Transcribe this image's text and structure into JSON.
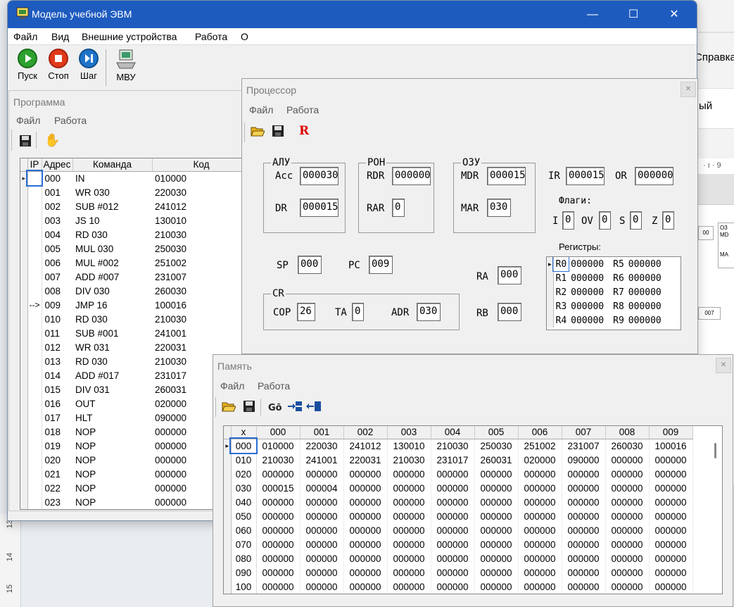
{
  "app": {
    "title": "Модель учебной ЭВМ"
  },
  "menu": [
    "Файл",
    "Вид",
    "Внешние устройства",
    "Работа",
    "О"
  ],
  "toolbar": {
    "run": "Пуск",
    "stop": "Стоп",
    "step": "Шаг",
    "mvu": "МВУ"
  },
  "background": {
    "help": "Справка",
    "word": "ый",
    "ruler": "· ı · 9",
    "ruler_left": [
      "15",
      "14",
      "13"
    ],
    "mini_o3": "О3",
    "mini_md": "МD",
    "mini_ma": "МА",
    "mini_00": "00",
    "mini_007": "007"
  },
  "program": {
    "title": "Программа",
    "menu": [
      "Файл",
      "Работа"
    ],
    "columns": [
      "IP",
      "Адрес",
      "Команда",
      "Код"
    ],
    "rows": [
      {
        "ip": "",
        "addr": "000",
        "cmd": "IN",
        "code": "010000"
      },
      {
        "ip": "",
        "addr": "001",
        "cmd": "WR 030",
        "code": "220030"
      },
      {
        "ip": "",
        "addr": "002",
        "cmd": "SUB #012",
        "code": "241012"
      },
      {
        "ip": "",
        "addr": "003",
        "cmd": "JS 10",
        "code": "130010"
      },
      {
        "ip": "",
        "addr": "004",
        "cmd": "RD 030",
        "code": "210030"
      },
      {
        "ip": "",
        "addr": "005",
        "cmd": "MUL 030",
        "code": "250030"
      },
      {
        "ip": "",
        "addr": "006",
        "cmd": "MUL #002",
        "code": "251002"
      },
      {
        "ip": "",
        "addr": "007",
        "cmd": "ADD #007",
        "code": "231007"
      },
      {
        "ip": "",
        "addr": "008",
        "cmd": "DIV 030",
        "code": "260030"
      },
      {
        "ip": "-->",
        "addr": "009",
        "cmd": "JMP 16",
        "code": "100016"
      },
      {
        "ip": "",
        "addr": "010",
        "cmd": "RD 030",
        "code": "210030"
      },
      {
        "ip": "",
        "addr": "011",
        "cmd": "SUB #001",
        "code": "241001"
      },
      {
        "ip": "",
        "addr": "012",
        "cmd": "WR 031",
        "code": "220031"
      },
      {
        "ip": "",
        "addr": "013",
        "cmd": "RD 030",
        "code": "210030"
      },
      {
        "ip": "",
        "addr": "014",
        "cmd": "ADD #017",
        "code": "231017"
      },
      {
        "ip": "",
        "addr": "015",
        "cmd": "DIV 031",
        "code": "260031"
      },
      {
        "ip": "",
        "addr": "016",
        "cmd": "OUT",
        "code": "020000"
      },
      {
        "ip": "",
        "addr": "017",
        "cmd": "HLT",
        "code": "090000"
      },
      {
        "ip": "",
        "addr": "018",
        "cmd": "NOP",
        "code": "000000"
      },
      {
        "ip": "",
        "addr": "019",
        "cmd": "NOP",
        "code": "000000"
      },
      {
        "ip": "",
        "addr": "020",
        "cmd": "NOP",
        "code": "000000"
      },
      {
        "ip": "",
        "addr": "021",
        "cmd": "NOP",
        "code": "000000"
      },
      {
        "ip": "",
        "addr": "022",
        "cmd": "NOP",
        "code": "000000"
      },
      {
        "ip": "",
        "addr": "023",
        "cmd": "NOP",
        "code": "000000"
      }
    ]
  },
  "processor": {
    "title": "Процессор",
    "menu": [
      "Файл",
      "Работа"
    ],
    "r_button": "R",
    "alu": {
      "label": "АЛУ",
      "acc_label": "Acc",
      "acc": "000030",
      "dr_label": "DR",
      "dr": "000015"
    },
    "ron": {
      "label": "РОН",
      "rdr_label": "RDR",
      "rdr": "000000",
      "rar_label": "RAR",
      "rar": "0"
    },
    "ozu": {
      "label": "ОЗУ",
      "mdr_label": "MDR",
      "mdr": "000015",
      "mar_label": "MAR",
      "mar": "030"
    },
    "ir_label": "IR",
    "ir": "000015",
    "or_label": "OR",
    "or": "000000",
    "flags": {
      "label": "Флаги:",
      "i_label": "I",
      "i": "0",
      "ov_label": "OV",
      "ov": "0",
      "s_label": "S",
      "s": "0",
      "z_label": "Z",
      "z": "0"
    },
    "sp_label": "SP",
    "sp": "000",
    "pc_label": "PC",
    "pc": "009",
    "cr": {
      "label": "CR",
      "cop_label": "COP",
      "cop": "26",
      "ta_label": "TA",
      "ta": "0",
      "adr_label": "ADR",
      "adr": "030"
    },
    "ra_label": "RA",
    "ra": "000",
    "rb_label": "RB",
    "rb": "000",
    "registers_label": "Регистры:",
    "registers": [
      {
        "n1": "R0",
        "v1": "000000",
        "n2": "R5",
        "v2": "000000"
      },
      {
        "n1": "R1",
        "v1": "000000",
        "n2": "R6",
        "v2": "000000"
      },
      {
        "n1": "R2",
        "v1": "000000",
        "n2": "R7",
        "v2": "000000"
      },
      {
        "n1": "R3",
        "v1": "000000",
        "n2": "R8",
        "v2": "000000"
      },
      {
        "n1": "R4",
        "v1": "000000",
        "n2": "R9",
        "v2": "000000"
      }
    ]
  },
  "memory": {
    "title": "Память",
    "menu": [
      "Файл",
      "Работа"
    ],
    "columns": [
      "x",
      "000",
      "001",
      "002",
      "003",
      "004",
      "005",
      "006",
      "007",
      "008",
      "009"
    ],
    "rows": [
      {
        "addr": "000",
        "cells": [
          "010000",
          "220030",
          "241012",
          "130010",
          "210030",
          "250030",
          "251002",
          "231007",
          "260030",
          "100016"
        ]
      },
      {
        "addr": "010",
        "cells": [
          "210030",
          "241001",
          "220031",
          "210030",
          "231017",
          "260031",
          "020000",
          "090000",
          "000000",
          "000000"
        ]
      },
      {
        "addr": "020",
        "cells": [
          "000000",
          "000000",
          "000000",
          "000000",
          "000000",
          "000000",
          "000000",
          "000000",
          "000000",
          "000000"
        ]
      },
      {
        "addr": "030",
        "cells": [
          "000015",
          "000004",
          "000000",
          "000000",
          "000000",
          "000000",
          "000000",
          "000000",
          "000000",
          "000000"
        ]
      },
      {
        "addr": "040",
        "cells": [
          "000000",
          "000000",
          "000000",
          "000000",
          "000000",
          "000000",
          "000000",
          "000000",
          "000000",
          "000000"
        ]
      },
      {
        "addr": "050",
        "cells": [
          "000000",
          "000000",
          "000000",
          "000000",
          "000000",
          "000000",
          "000000",
          "000000",
          "000000",
          "000000"
        ]
      },
      {
        "addr": "060",
        "cells": [
          "000000",
          "000000",
          "000000",
          "000000",
          "000000",
          "000000",
          "000000",
          "000000",
          "000000",
          "000000"
        ]
      },
      {
        "addr": "070",
        "cells": [
          "000000",
          "000000",
          "000000",
          "000000",
          "000000",
          "000000",
          "000000",
          "000000",
          "000000",
          "000000"
        ]
      },
      {
        "addr": "080",
        "cells": [
          "000000",
          "000000",
          "000000",
          "000000",
          "000000",
          "000000",
          "000000",
          "000000",
          "000000",
          "000000"
        ]
      },
      {
        "addr": "090",
        "cells": [
          "000000",
          "000000",
          "000000",
          "000000",
          "000000",
          "000000",
          "000000",
          "000000",
          "000000",
          "000000"
        ]
      },
      {
        "addr": "100",
        "cells": [
          "000000",
          "000000",
          "000000",
          "000000",
          "000000",
          "000000",
          "000000",
          "000000",
          "000000",
          "000000"
        ]
      }
    ]
  }
}
